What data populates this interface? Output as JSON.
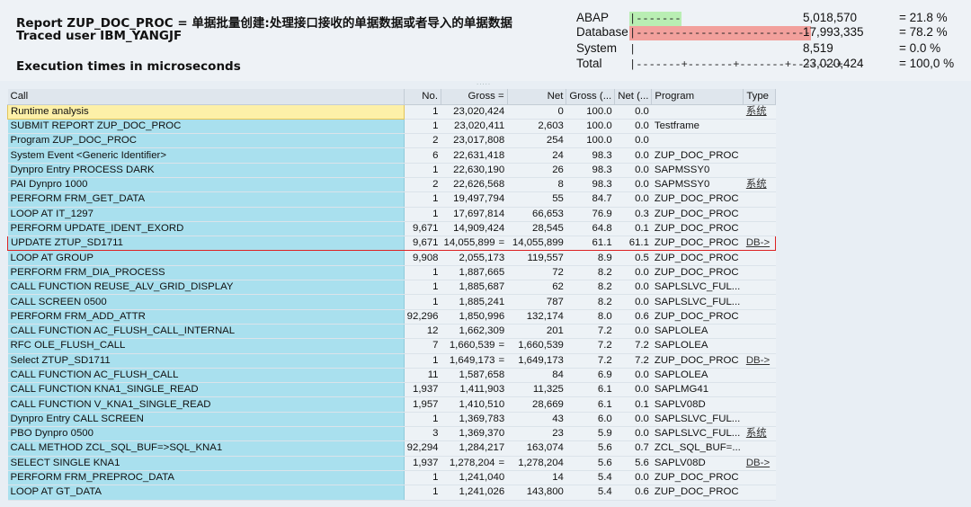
{
  "header": {
    "report_title": "Report ZUP_DOC_PROC = 单据批量创建:处理接口接收的单据数据或者导入的单据数据",
    "traced_user": "Traced user IBM_YANGJF",
    "execution_times": "Execution times in microseconds",
    "summary": [
      {
        "label": "ABAP",
        "bar": "|-------",
        "bar_color": "#b9eeb3",
        "value": "5,018,570",
        "pct": "= 21.8 %"
      },
      {
        "label": "Database",
        "bar": "|---------------------------",
        "bar_color": "#f2a09c",
        "value": "17,993,335",
        "pct": "= 78.2 %"
      },
      {
        "label": "System",
        "bar": "|",
        "bar_color": "",
        "value": "8,519",
        "pct": "= 0.0 %"
      },
      {
        "label": "Total",
        "bar": "|-------+-------+-------+-------+",
        "bar_color": "",
        "value": "23,020,424",
        "pct": "= 100,0 %"
      }
    ]
  },
  "columns": [
    "Call",
    "No.",
    "Gross =",
    "Net",
    "Gross (...",
    "Net (...",
    "Program",
    "Type"
  ],
  "rows": [
    {
      "call": "Runtime analysis",
      "no": "1",
      "gross": "23,020,424",
      "eq": "",
      "net": "0",
      "gpct": "100.0",
      "npct": "0.0",
      "program": "",
      "type": "系统",
      "type_link": true,
      "selected": true
    },
    {
      "call": "SUBMIT REPORT ZUP_DOC_PROC",
      "no": "1",
      "gross": "23,020,411",
      "eq": "",
      "net": "2,603",
      "gpct": "100.0",
      "npct": "0.0",
      "program": "Testframe",
      "type": ""
    },
    {
      "call": "Program ZUP_DOC_PROC",
      "no": "2",
      "gross": "23,017,808",
      "eq": "",
      "net": "254",
      "gpct": "100.0",
      "npct": "0.0",
      "program": "",
      "type": ""
    },
    {
      "call": "System Event <Generic Identifier>",
      "no": "6",
      "gross": "22,631,418",
      "eq": "",
      "net": "24",
      "gpct": "98.3",
      "npct": "0.0",
      "program": "ZUP_DOC_PROC",
      "type": ""
    },
    {
      "call": "Dynpro Entry PROCESS DARK",
      "no": "1",
      "gross": "22,630,190",
      "eq": "",
      "net": "26",
      "gpct": "98.3",
      "npct": "0.0",
      "program": "SAPMSSY0",
      "type": ""
    },
    {
      "call": "PAI Dynpro 1000",
      "no": "2",
      "gross": "22,626,568",
      "eq": "",
      "net": "8",
      "gpct": "98.3",
      "npct": "0.0",
      "program": "SAPMSSY0",
      "type": "系统",
      "type_link": true
    },
    {
      "call": "PERFORM FRM_GET_DATA",
      "no": "1",
      "gross": "19,497,794",
      "eq": "",
      "net": "55",
      "gpct": "84.7",
      "npct": "0.0",
      "program": "ZUP_DOC_PROC",
      "type": ""
    },
    {
      "call": "LOOP AT IT_1297",
      "no": "1",
      "gross": "17,697,814",
      "eq": "",
      "net": "66,653",
      "gpct": "76.9",
      "npct": "0.3",
      "program": "ZUP_DOC_PROC",
      "type": ""
    },
    {
      "call": "PERFORM UPDATE_IDENT_EXORD",
      "no": "9,671",
      "gross": "14,909,424",
      "eq": "",
      "net": "28,545",
      "gpct": "64.8",
      "npct": "0.1",
      "program": "ZUP_DOC_PROC",
      "type": ""
    },
    {
      "call": "UPDATE ZTUP_SD1711",
      "no": "9,671",
      "gross": "14,055,899",
      "eq": "=",
      "net": "14,055,899",
      "gpct": "61.1",
      "npct": "61.1",
      "program": "ZUP_DOC_PROC",
      "type": "DB->",
      "type_link": true,
      "highlight": true
    },
    {
      "call": "LOOP AT GROUP",
      "no": "9,908",
      "gross": "2,055,173",
      "eq": "",
      "net": "119,557",
      "gpct": "8.9",
      "npct": "0.5",
      "program": "ZUP_DOC_PROC",
      "type": ""
    },
    {
      "call": "PERFORM FRM_DIA_PROCESS",
      "no": "1",
      "gross": "1,887,665",
      "eq": "",
      "net": "72",
      "gpct": "8.2",
      "npct": "0.0",
      "program": "ZUP_DOC_PROC",
      "type": ""
    },
    {
      "call": "CALL FUNCTION REUSE_ALV_GRID_DISPLAY",
      "no": "1",
      "gross": "1,885,687",
      "eq": "",
      "net": "62",
      "gpct": "8.2",
      "npct": "0.0",
      "program": "SAPLSLVC_FUL...",
      "type": ""
    },
    {
      "call": "CALL SCREEN 0500",
      "no": "1",
      "gross": "1,885,241",
      "eq": "",
      "net": "787",
      "gpct": "8.2",
      "npct": "0.0",
      "program": "SAPLSLVC_FUL...",
      "type": ""
    },
    {
      "call": "PERFORM FRM_ADD_ATTR",
      "no": "92,296",
      "gross": "1,850,996",
      "eq": "",
      "net": "132,174",
      "gpct": "8.0",
      "npct": "0.6",
      "program": "ZUP_DOC_PROC",
      "type": ""
    },
    {
      "call": "CALL FUNCTION AC_FLUSH_CALL_INTERNAL",
      "no": "12",
      "gross": "1,662,309",
      "eq": "",
      "net": "201",
      "gpct": "7.2",
      "npct": "0.0",
      "program": "SAPLOLEA",
      "type": ""
    },
    {
      "call": "RFC OLE_FLUSH_CALL",
      "no": "7",
      "gross": "1,660,539",
      "eq": "=",
      "net": "1,660,539",
      "gpct": "7.2",
      "npct": "7.2",
      "program": "SAPLOLEA",
      "type": ""
    },
    {
      "call": "Select ZTUP_SD1711",
      "no": "1",
      "gross": "1,649,173",
      "eq": "=",
      "net": "1,649,173",
      "gpct": "7.2",
      "npct": "7.2",
      "program": "ZUP_DOC_PROC",
      "type": "DB->",
      "type_link": true
    },
    {
      "call": "CALL FUNCTION AC_FLUSH_CALL",
      "no": "11",
      "gross": "1,587,658",
      "eq": "",
      "net": "84",
      "gpct": "6.9",
      "npct": "0.0",
      "program": "SAPLOLEA",
      "type": ""
    },
    {
      "call": "CALL FUNCTION KNA1_SINGLE_READ",
      "no": "1,937",
      "gross": "1,411,903",
      "eq": "",
      "net": "11,325",
      "gpct": "6.1",
      "npct": "0.0",
      "program": "SAPLMG41",
      "type": ""
    },
    {
      "call": "CALL FUNCTION V_KNA1_SINGLE_READ",
      "no": "1,957",
      "gross": "1,410,510",
      "eq": "",
      "net": "28,669",
      "gpct": "6.1",
      "npct": "0.1",
      "program": "SAPLV08D",
      "type": ""
    },
    {
      "call": "Dynpro Entry CALL SCREEN",
      "no": "1",
      "gross": "1,369,783",
      "eq": "",
      "net": "43",
      "gpct": "6.0",
      "npct": "0.0",
      "program": "SAPLSLVC_FUL...",
      "type": ""
    },
    {
      "call": "PBO Dynpro 0500",
      "no": "3",
      "gross": "1,369,370",
      "eq": "",
      "net": "23",
      "gpct": "5.9",
      "npct": "0.0",
      "program": "SAPLSLVC_FUL...",
      "type": "系统",
      "type_link": true
    },
    {
      "call": "CALL METHOD ZCL_SQL_BUF=>SQL_KNA1",
      "no": "92,294",
      "gross": "1,284,217",
      "eq": "",
      "net": "163,074",
      "gpct": "5.6",
      "npct": "0.7",
      "program": "ZCL_SQL_BUF=...",
      "type": ""
    },
    {
      "call": "SELECT SINGLE KNA1",
      "no": "1,937",
      "gross": "1,278,204",
      "eq": "=",
      "net": "1,278,204",
      "gpct": "5.6",
      "npct": "5.6",
      "program": "SAPLV08D",
      "type": "DB->",
      "type_link": true
    },
    {
      "call": "PERFORM FRM_PREPROC_DATA",
      "no": "1",
      "gross": "1,241,040",
      "eq": "",
      "net": "14",
      "gpct": "5.4",
      "npct": "0.0",
      "program": "ZUP_DOC_PROC",
      "type": ""
    },
    {
      "call": "LOOP AT GT_DATA",
      "no": "1",
      "gross": "1,241,026",
      "eq": "",
      "net": "143,800",
      "gpct": "5.4",
      "npct": "0.6",
      "program": "ZUP_DOC_PROC",
      "type": ""
    }
  ]
}
